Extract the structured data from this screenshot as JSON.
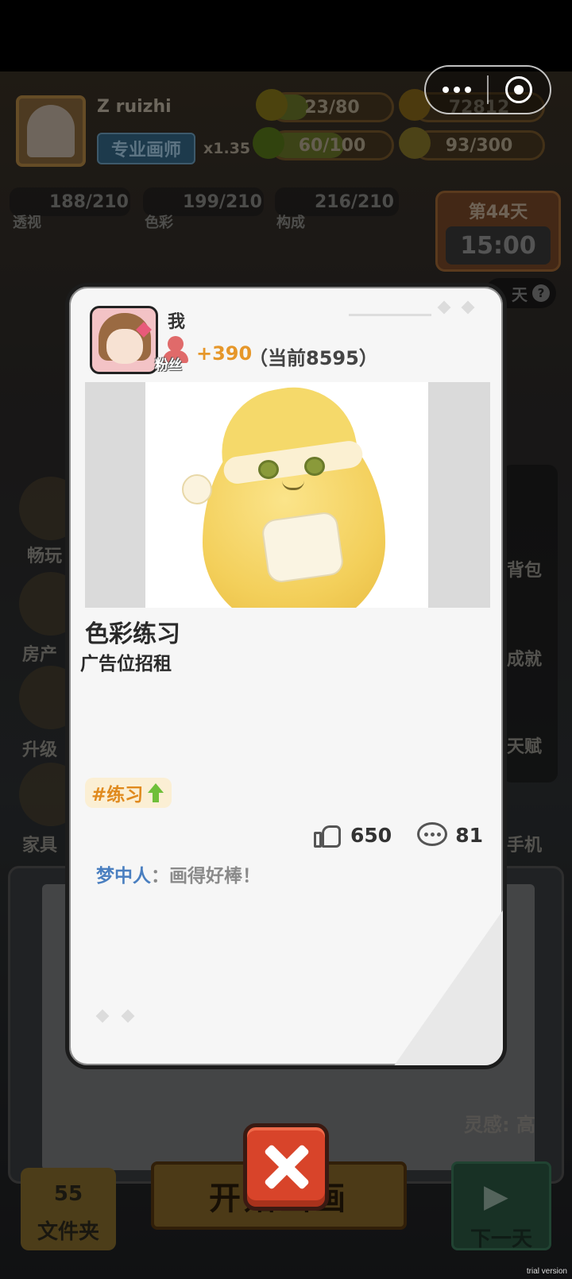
{
  "capsule": {
    "menu_icon": "more-dots-icon",
    "close_icon": "target-icon"
  },
  "header": {
    "username": "Z ruizhi",
    "rank": "专业画师",
    "multiplier": "x1.35",
    "energy": "23/80",
    "coins": "72812",
    "health": "60/100",
    "ideas": "93/300"
  },
  "skills": [
    {
      "value": "188/210",
      "label": "透视"
    },
    {
      "value": "199/210",
      "label": "色彩"
    },
    {
      "value": "216/210",
      "label": "构成"
    }
  ],
  "day": {
    "title": "第44天",
    "clock": "15:00",
    "sub": "天"
  },
  "side_left": [
    "畅玩",
    "房产",
    "升级",
    "家具"
  ],
  "side_right": [
    "背包",
    "成就",
    "天赋",
    "手机"
  ],
  "bottom": {
    "folder_count": "55",
    "folder_label": "文件夹",
    "start_label": "开始画画",
    "next_day": "下一天",
    "inspiration": "灵感: 高"
  },
  "post": {
    "author": "我",
    "fans_label": "粉丝",
    "fans_gain": "+390",
    "fans_total": "（当前8595）",
    "title": "色彩练习",
    "subtitle": "广告位招租",
    "tag": "#练习",
    "likes": "650",
    "comments": "81",
    "comment_user": "梦中人",
    "comment_colon": "：",
    "comment_text": "画得好棒！"
  },
  "watermark": "trial version",
  "colors": {
    "accent": "#e6972a",
    "commenter": "#4a7fc0",
    "close": "#d8442a"
  }
}
